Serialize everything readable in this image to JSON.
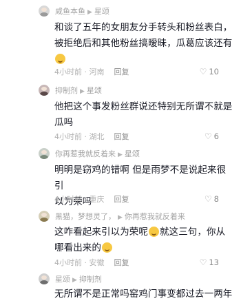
{
  "comments": [
    {
      "author": "咸鱼本鱼",
      "reply_to": "星颂",
      "text_lines": [
        "和谈了五年的女朋友分手转头和粉丝表白，",
        "被拒绝后和其他粉丝搞暧昧，瓜葛应该还有"
      ],
      "time": "4小时前",
      "location": "河南",
      "reply_label": "回复",
      "likes": "10"
    },
    {
      "author": "抑制剂",
      "reply_to": "星颂",
      "text_lines": [
        "他把这个事发粉丝群说还特别无所谓不就是",
        "瓜吗"
      ],
      "time": "4小时前",
      "location": "湖北",
      "reply_label": "回复",
      "likes": "6"
    },
    {
      "author": "你再惹我就反着来",
      "reply_to": "星颂",
      "text_lines": [
        "明明是窃鸡的错啊 但是雨梦不是说起来很引",
        "以为荣吗"
      ],
      "time": "4小时前",
      "location": "重庆",
      "reply_label": "回复",
      "likes": "8"
    },
    {
      "author": "黑猫，梦想灵了，",
      "reply_to": "你再惹我就反着来",
      "text_lines": [
        "这咋看起来引以为荣呢",
        "就这三句，你从",
        "哪看出来的"
      ],
      "time": "4小时前",
      "location": "安徽",
      "reply_label": "回复",
      "likes": "13"
    },
    {
      "author": "星颂",
      "reply_to": "抑制剂",
      "text_lines": [
        "无所谓不是正常吗窑鸡门事变都过去一两年"
      ]
    }
  ],
  "icons": {
    "like": "heart-outline-icon",
    "reply_arrow": "triangle-right-icon"
  }
}
